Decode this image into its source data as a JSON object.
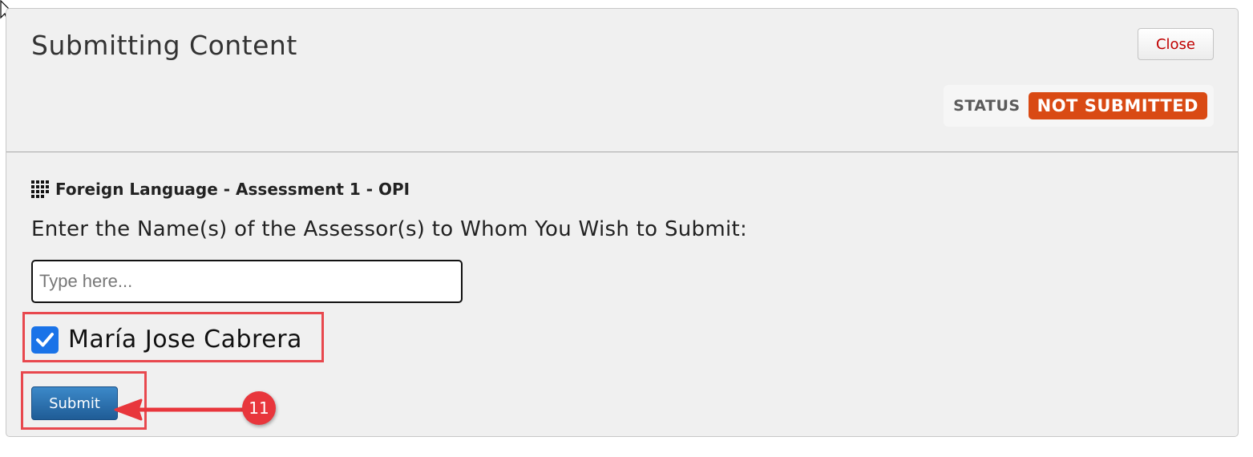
{
  "dialog": {
    "title": "Submitting Content",
    "close_label": "Close",
    "status_label": "STATUS",
    "status_value": "NOT SUBMITTED"
  },
  "assessment": {
    "title": "Foreign Language - Assessment 1 - OPI",
    "prompt": "Enter the Name(s) of the Assessor(s) to Whom You Wish to Submit:",
    "input_placeholder": "Type here...",
    "assessors": [
      {
        "name": "María Jose Cabrera",
        "checked": true
      }
    ],
    "submit_label": "Submit"
  },
  "annotation": {
    "step_number": "11",
    "highlight_color": "#e8484e",
    "badge_color": "#e8363c"
  },
  "colors": {
    "status_badge": "#d94a14",
    "submit_button": "#2a6fae",
    "checkbox": "#1a73e8",
    "close_text": "#c00000"
  }
}
